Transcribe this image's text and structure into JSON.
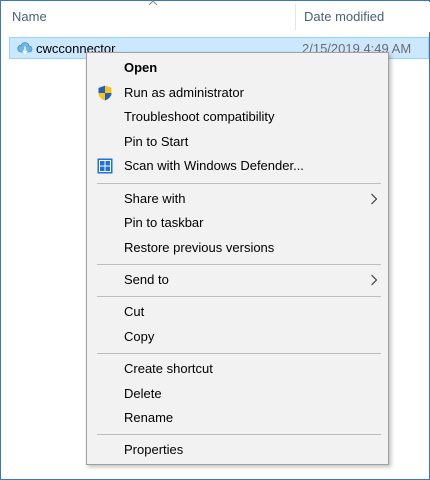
{
  "columns": {
    "name": "Name",
    "date_modified": "Date modified"
  },
  "file": {
    "name": "cwcconnector",
    "date": "2/15/2019 4:49 AM",
    "icon": "cloud-download-icon"
  },
  "menu": {
    "open": "Open",
    "run_as_admin": "Run as administrator",
    "troubleshoot": "Troubleshoot compatibility",
    "pin_start": "Pin to Start",
    "scan_defender": "Scan with Windows Defender...",
    "share_with": "Share with",
    "pin_taskbar": "Pin to taskbar",
    "restore_versions": "Restore previous versions",
    "send_to": "Send to",
    "cut": "Cut",
    "copy": "Copy",
    "create_shortcut": "Create shortcut",
    "delete": "Delete",
    "rename": "Rename",
    "properties": "Properties"
  },
  "colors": {
    "selection_bg": "#cce8ff",
    "selection_border": "#99d1ff",
    "menu_bg": "#f2f2f2",
    "frame_border": "#3c78b4"
  }
}
